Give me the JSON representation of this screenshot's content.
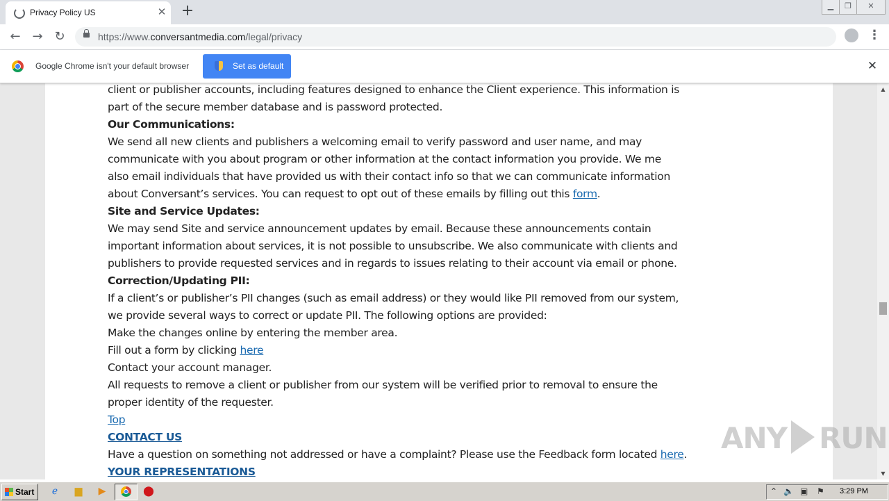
{
  "browser": {
    "tab_title": "Privacy Policy US",
    "url_scheme": "https://www.",
    "url_host": "conversantmedia.com",
    "url_path": "/legal/privacy",
    "infobar_message": "Google Chrome isn't your default browser",
    "set_default_label": "Set as default"
  },
  "page": {
    "p1_line1": "client or publisher accounts, including features designed to enhance the Client experience. This information is",
    "p1_line2": "part of the secure member database and is password protected.",
    "comms_heading": "Our Communications:",
    "comms_line1": "We send all new clients and publishers a welcoming email to verify password and user name, and may",
    "comms_line2": "communicate with you about program or other information at the contact information you provide.  We me",
    "comms_line3": "also email individuals that have provided us with their contact info so that we can communicate information",
    "comms_line4": "about Conversant’s services.  You can request to opt out of these emails by filling out this ",
    "comms_link": "form",
    "comms_end": ".",
    "updates_heading": "Site and Service Updates:",
    "updates_line1": "We may send Site and service announcement updates by email. Because these announcements contain",
    "updates_line2": "important information about services, it is not possible to unsubscribe. We also communicate with clients and",
    "updates_line3": "publishers to provide requested services and in regards to issues relating to their account via email or phone.",
    "correction_heading": "Correction/Updating PII:",
    "correction_line1": "If a client’s or publisher’s PII changes (such as email address) or they would like PII removed from our system,",
    "correction_line2": "we provide several ways to correct or update PII. The following options are provided:",
    "option1": "Make the changes online by entering the member area.",
    "option2_text": "Fill out a form by clicking ",
    "option2_link": "here",
    "option3": "Contact your account manager.",
    "removal_line1": "All requests to remove a client or publisher from our system will be verified prior to removal to ensure the",
    "removal_line2": "proper identity of the requester.",
    "top_link": "Top",
    "contact_heading": "CONTACT US",
    "contact_text": "Have a question on something not addressed or have a complaint? Please use the Feedback form located ",
    "contact_link": "here",
    "contact_end": ".",
    "representations_heading": "YOUR REPRESENTATIONS"
  },
  "watermark": {
    "left": "ANY",
    "right": "RUN"
  },
  "taskbar": {
    "start_label": "Start",
    "clock": "3:29 PM"
  },
  "colors": {
    "link": "#1a6ab0",
    "accent": "#4285f4"
  }
}
